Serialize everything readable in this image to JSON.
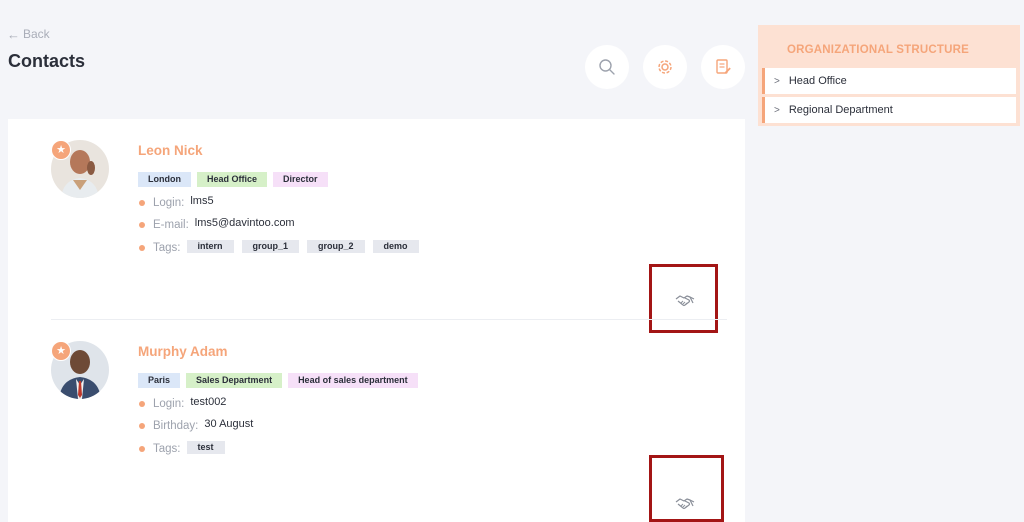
{
  "header": {
    "back_label": "Back",
    "title": "Contacts"
  },
  "toolbar": {
    "icons": [
      "search-icon",
      "gear-icon",
      "document-edit-icon"
    ]
  },
  "contacts": [
    {
      "name": "Leon Nick",
      "badges": [
        "London",
        "Head Office",
        "Director"
      ],
      "fields": [
        {
          "label": "Login:",
          "value": "lms5"
        },
        {
          "label": "E-mail:",
          "value": "lms5@davintoo.com"
        }
      ],
      "tags_label": "Tags:",
      "tags": [
        "intern",
        "group_1",
        "group_2",
        "demo"
      ]
    },
    {
      "name": "Murphy Adam",
      "badges": [
        "Paris",
        "Sales Department",
        "Head of sales department"
      ],
      "fields": [
        {
          "label": "Login:",
          "value": "test002"
        },
        {
          "label": "Birthday:",
          "value": "30 August"
        }
      ],
      "tags_label": "Tags:",
      "tags": [
        "test"
      ]
    }
  ],
  "org_panel": {
    "title": "ORGANIZATIONAL STRUCTURE",
    "items": [
      "Head Office",
      "Regional Department"
    ]
  },
  "colors": {
    "accent": "#f5a57a",
    "highlight": "#a31515",
    "background": "#f4f5f9"
  }
}
